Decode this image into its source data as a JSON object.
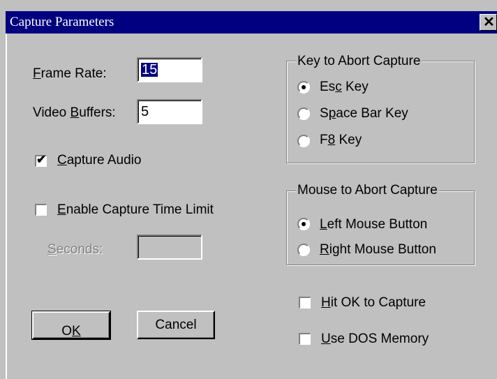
{
  "window": {
    "title": "Capture Parameters",
    "close_glyph": "✕"
  },
  "frame_rate": {
    "label_pre": "",
    "label_key": "F",
    "label_post": "rame Rate:",
    "value": "15"
  },
  "video_buffers": {
    "label_pre": "Video ",
    "label_key": "B",
    "label_post": "uffers:",
    "value": "5"
  },
  "capture_audio": {
    "label_pre": "",
    "label_key": "C",
    "label_post": "apture Audio",
    "checked": true
  },
  "enable_time_limit": {
    "label_pre": "",
    "label_key": "E",
    "label_post": "nable Capture Time Limit",
    "checked": false
  },
  "seconds": {
    "label_pre": "",
    "label_key": "S",
    "label_post": "econds:",
    "value": ""
  },
  "key_group": {
    "title": "Key to Abort Capture",
    "options": [
      {
        "pre": "Es",
        "key": "c",
        "post": " Key",
        "selected": true
      },
      {
        "pre": "S",
        "key": "p",
        "post": "ace Bar Key",
        "selected": false
      },
      {
        "pre": "F",
        "key": "8",
        "post": " Key",
        "selected": false
      }
    ]
  },
  "mouse_group": {
    "title": "Mouse to Abort Capture",
    "options": [
      {
        "pre": "",
        "key": "L",
        "post": "eft Mouse Button",
        "selected": true
      },
      {
        "pre": "",
        "key": "R",
        "post": "ight Mouse Button",
        "selected": false
      }
    ]
  },
  "hit_ok": {
    "label_pre": "",
    "label_key": "H",
    "label_post": "it OK to Capture",
    "checked": false
  },
  "dos_memory": {
    "label_pre": "",
    "label_key": "U",
    "label_post": "se DOS Memory",
    "checked": false
  },
  "buttons": {
    "ok": {
      "pre": "O",
      "key": "K",
      "post": ""
    },
    "cancel": "Cancel"
  },
  "icons": {
    "check_mark": "✔",
    "radio_dot": "radio-dot"
  }
}
